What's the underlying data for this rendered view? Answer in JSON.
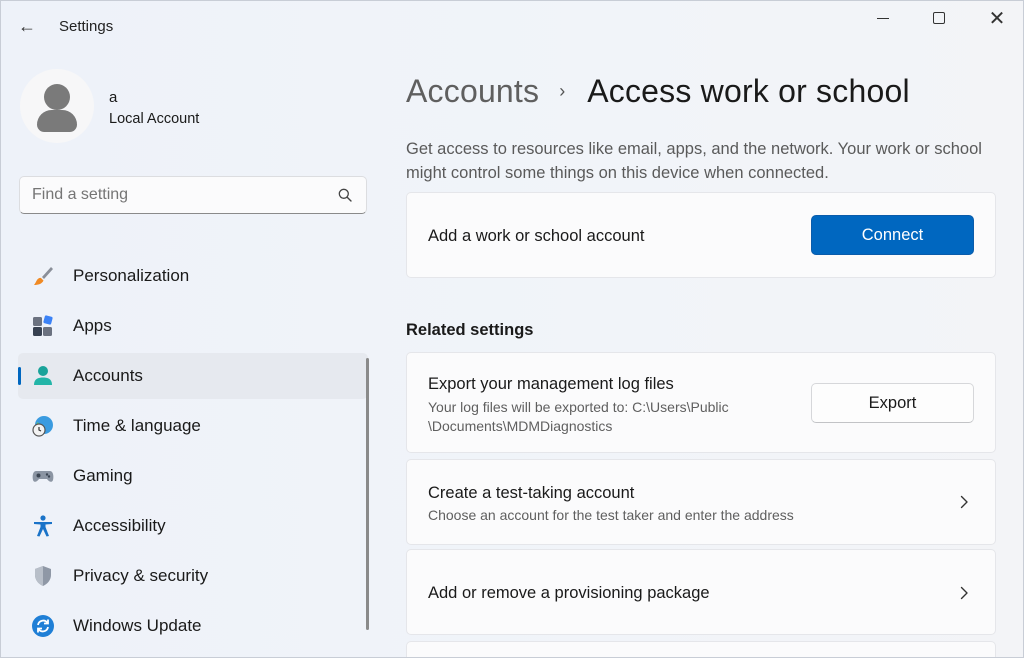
{
  "app": {
    "title": "Settings",
    "back": "←",
    "close": "✕"
  },
  "profile": {
    "name": "a",
    "account_type": "Local Account"
  },
  "search": {
    "placeholder": "Find a setting"
  },
  "nav": {
    "items": [
      {
        "label": "Personalization",
        "icon": "paintbrush-icon",
        "active": false
      },
      {
        "label": "Apps",
        "icon": "apps-icon",
        "active": false
      },
      {
        "label": "Accounts",
        "icon": "person-icon",
        "active": true
      },
      {
        "label": "Time & language",
        "icon": "globe-clock-icon",
        "active": false
      },
      {
        "label": "Gaming",
        "icon": "gamepad-icon",
        "active": false
      },
      {
        "label": "Accessibility",
        "icon": "accessibility-icon",
        "active": false
      },
      {
        "label": "Privacy & security",
        "icon": "shield-icon",
        "active": false
      },
      {
        "label": "Windows Update",
        "icon": "update-icon",
        "active": false
      }
    ]
  },
  "main": {
    "breadcrumb_parent": "Accounts",
    "breadcrumb_separator": "›",
    "page_title": "Access work or school",
    "description": "Get access to resources like email, apps, and the network. Your work or school might control some things on this device when connected.",
    "connect_card": {
      "title": "Add a work or school account",
      "button": "Connect"
    },
    "related_heading": "Related settings",
    "export_card": {
      "title": "Export your management log files",
      "subtitle_line1": "Your log files will be exported to: C:\\Users\\Public",
      "subtitle_line2": "\\Documents\\MDMDiagnostics",
      "button": "Export"
    },
    "test_card": {
      "title": "Create a test-taking account",
      "subtitle": "Choose an account for the test taker and enter the address"
    },
    "provisioning_card": {
      "title": "Add or remove a provisioning package"
    }
  },
  "colors": {
    "accent": "#0067c0",
    "background": "#eef2f8",
    "card": "#fbfbfc"
  }
}
